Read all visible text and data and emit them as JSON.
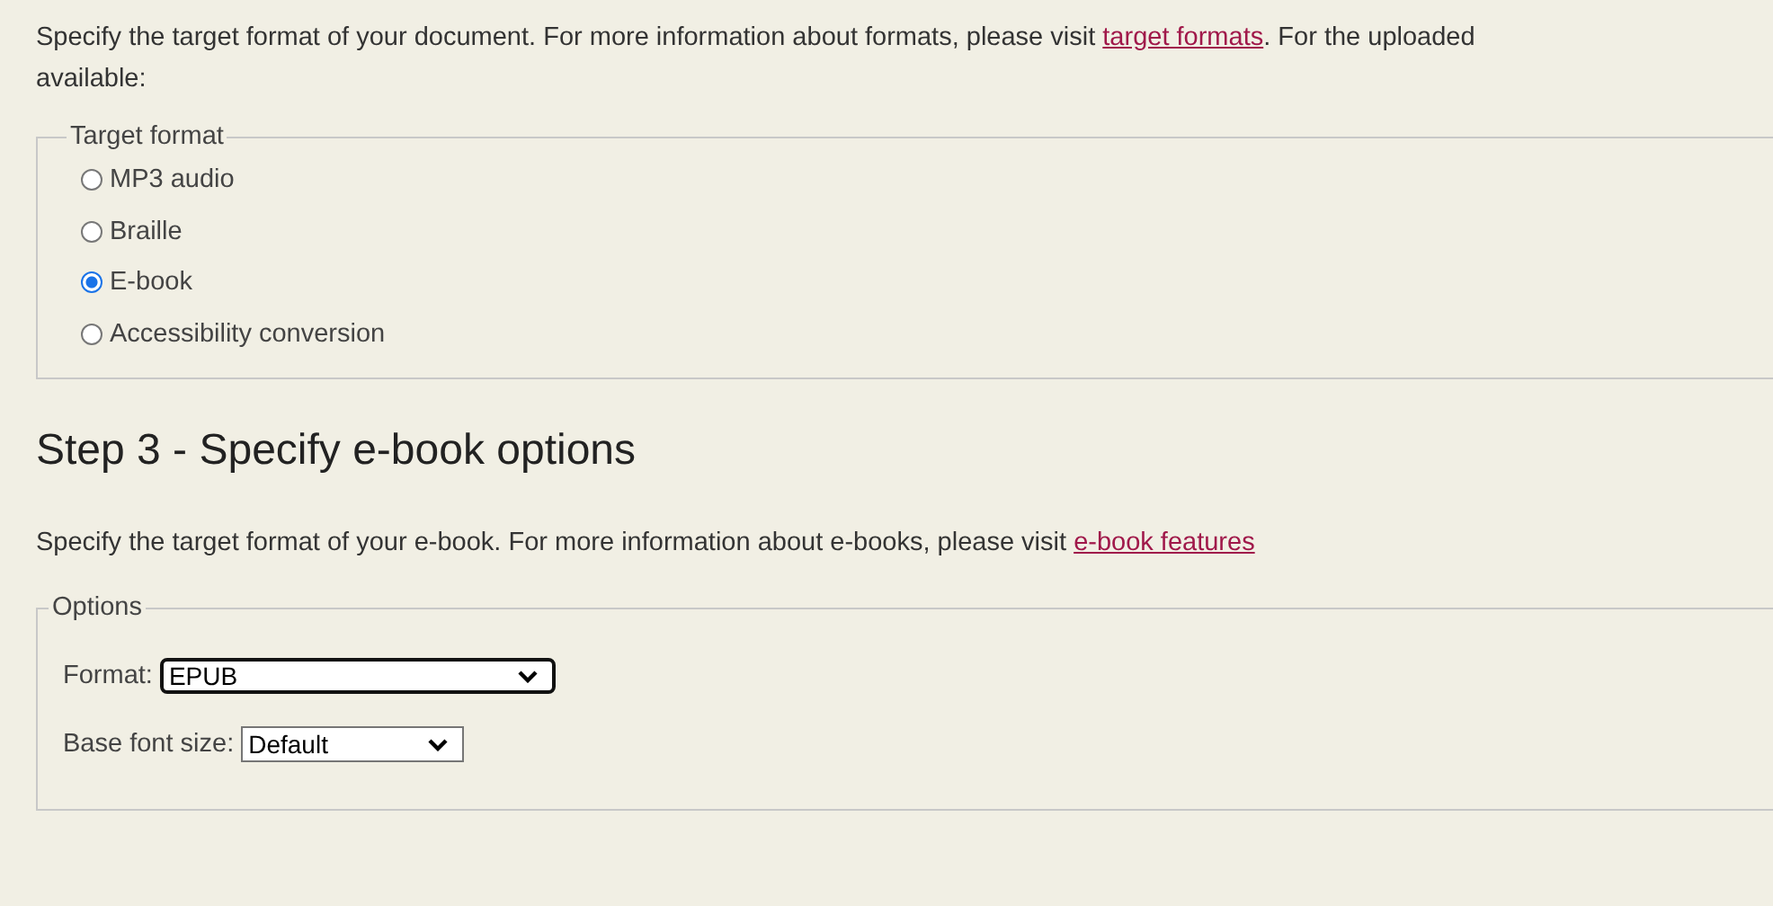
{
  "intro": {
    "before": "Specify the target format of your document. For more information about formats, please visit ",
    "link": "target formats",
    "after": ". For the uploaded",
    "continuation": "available:"
  },
  "target_format": {
    "legend": "Target format",
    "options": [
      {
        "label": "MP3 audio",
        "selected": false
      },
      {
        "label": "Braille",
        "selected": false
      },
      {
        "label": "E-book",
        "selected": true
      },
      {
        "label": "Accessibility conversion",
        "selected": false
      }
    ]
  },
  "step_heading": "Step 3 - Specify e-book options",
  "ebook_intro": {
    "before": "Specify the target format of your e-book. For more information about e-books, please visit ",
    "link": "e-book features"
  },
  "options": {
    "legend": "Options",
    "fields": [
      {
        "label": "Format:",
        "value": "EPUB",
        "focused": true
      },
      {
        "label": "Base font size:",
        "value": "Default",
        "focused": false
      }
    ]
  }
}
